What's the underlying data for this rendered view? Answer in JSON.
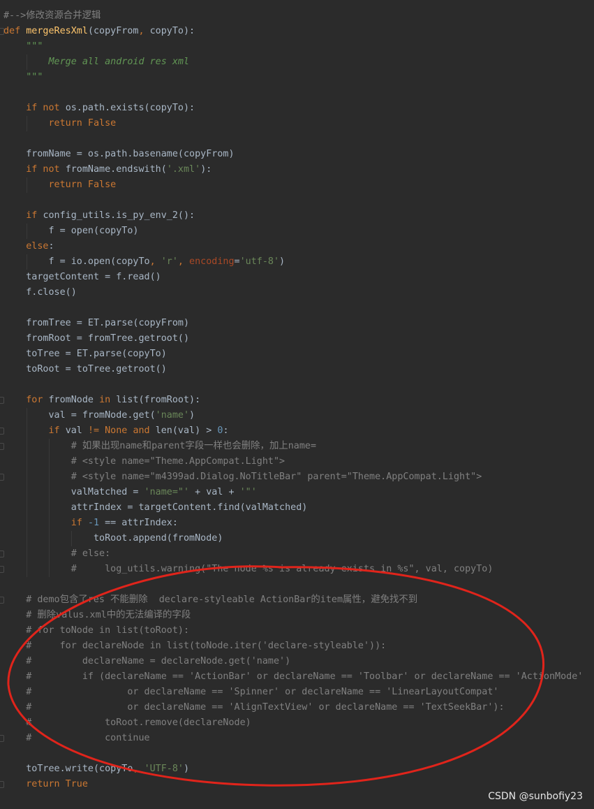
{
  "editor": {
    "lines": [
      {
        "tokens": [
          {
            "t": "#-->修改资源合并逻辑",
            "c": "cm"
          }
        ]
      },
      {
        "tokens": [
          {
            "t": "def ",
            "c": "kw"
          },
          {
            "t": "mergeResXml",
            "c": "fn"
          },
          {
            "t": "(",
            "c": "plain"
          },
          {
            "t": "copyFrom",
            "c": "plain"
          },
          {
            "t": ", ",
            "c": "kw"
          },
          {
            "t": "copyTo",
            "c": "plain"
          },
          {
            "t": "):",
            "c": "plain"
          }
        ],
        "fold": true
      },
      {
        "tokens": [
          {
            "t": "    \"\"\"",
            "c": "doc"
          }
        ]
      },
      {
        "tokens": [
          {
            "t": "        Merge all android res xml",
            "c": "doc"
          }
        ]
      },
      {
        "tokens": [
          {
            "t": "    \"\"\"",
            "c": "doc"
          }
        ]
      },
      {
        "tokens": []
      },
      {
        "tokens": [
          {
            "t": "    if not ",
            "c": "kw"
          },
          {
            "t": "os.path.exists(copyTo):",
            "c": "plain"
          }
        ]
      },
      {
        "tokens": [
          {
            "t": "        return False",
            "c": "kw"
          }
        ]
      },
      {
        "tokens": []
      },
      {
        "tokens": [
          {
            "t": "    fromName = os.path.basename(copyFrom)",
            "c": "plain"
          }
        ]
      },
      {
        "tokens": [
          {
            "t": "    if not ",
            "c": "kw"
          },
          {
            "t": "fromName.endswith(",
            "c": "plain"
          },
          {
            "t": "'.xml'",
            "c": "str"
          },
          {
            "t": "):",
            "c": "plain"
          }
        ]
      },
      {
        "tokens": [
          {
            "t": "        return False",
            "c": "kw"
          }
        ]
      },
      {
        "tokens": []
      },
      {
        "tokens": [
          {
            "t": "    if ",
            "c": "kw"
          },
          {
            "t": "config_utils.is_py_env_2():",
            "c": "plain"
          }
        ]
      },
      {
        "tokens": [
          {
            "t": "        f = open(copyTo)",
            "c": "plain"
          }
        ]
      },
      {
        "tokens": [
          {
            "t": "    else",
            "c": "kw"
          },
          {
            "t": ":",
            "c": "plain"
          }
        ]
      },
      {
        "tokens": [
          {
            "t": "        f = io.open(copyTo",
            "c": "plain"
          },
          {
            "t": ", ",
            "c": "kw"
          },
          {
            "t": "'r'",
            "c": "str"
          },
          {
            "t": ", ",
            "c": "kw"
          },
          {
            "t": "encoding",
            "c": "param"
          },
          {
            "t": "=",
            "c": "plain"
          },
          {
            "t": "'utf-8'",
            "c": "str"
          },
          {
            "t": ")",
            "c": "plain"
          }
        ]
      },
      {
        "tokens": [
          {
            "t": "    targetContent = f.read()",
            "c": "plain"
          }
        ]
      },
      {
        "tokens": [
          {
            "t": "    f.close()",
            "c": "plain"
          }
        ]
      },
      {
        "tokens": []
      },
      {
        "tokens": [
          {
            "t": "    fromTree = ET.parse(copyFrom)",
            "c": "plain"
          }
        ]
      },
      {
        "tokens": [
          {
            "t": "    fromRoot = fromTree.getroot()",
            "c": "plain"
          }
        ]
      },
      {
        "tokens": [
          {
            "t": "    toTree = ET.parse(copyTo)",
            "c": "plain"
          }
        ]
      },
      {
        "tokens": [
          {
            "t": "    toRoot = toTree.getroot()",
            "c": "plain"
          }
        ]
      },
      {
        "tokens": []
      },
      {
        "tokens": [
          {
            "t": "    for ",
            "c": "kw"
          },
          {
            "t": "fromNode ",
            "c": "plain"
          },
          {
            "t": "in ",
            "c": "kw"
          },
          {
            "t": "list(fromRoot):",
            "c": "plain"
          }
        ],
        "fold": true
      },
      {
        "tokens": [
          {
            "t": "        val = fromNode.get(",
            "c": "plain"
          },
          {
            "t": "'name'",
            "c": "str"
          },
          {
            "t": ")",
            "c": "plain"
          }
        ]
      },
      {
        "tokens": [
          {
            "t": "        if ",
            "c": "kw"
          },
          {
            "t": "val ",
            "c": "plain"
          },
          {
            "t": "!= None ",
            "c": "kw"
          },
          {
            "t": "and ",
            "c": "kw"
          },
          {
            "t": "len(val) > ",
            "c": "plain"
          },
          {
            "t": "0",
            "c": "num"
          },
          {
            "t": ":",
            "c": "plain"
          }
        ],
        "fold": true
      },
      {
        "tokens": [
          {
            "t": "            # 如果出现name和parent字段一样也会删除，加上name=",
            "c": "cm"
          }
        ],
        "fold": true
      },
      {
        "tokens": [
          {
            "t": "            # <style name=\"Theme.AppCompat.Light\">",
            "c": "cm"
          }
        ]
      },
      {
        "tokens": [
          {
            "t": "            # <style name=\"m4399ad.Dialog.NoTitleBar\" parent=\"Theme.AppCompat.Light\">",
            "c": "cm"
          }
        ],
        "fold": true
      },
      {
        "tokens": [
          {
            "t": "            valMatched = ",
            "c": "plain"
          },
          {
            "t": "'name=\"'",
            "c": "str"
          },
          {
            "t": " + val + ",
            "c": "plain"
          },
          {
            "t": "'\"'",
            "c": "str"
          }
        ]
      },
      {
        "tokens": [
          {
            "t": "            attrIndex = targetContent.find(valMatched)",
            "c": "plain"
          }
        ]
      },
      {
        "tokens": [
          {
            "t": "            if ",
            "c": "kw"
          },
          {
            "t": "-1",
            "c": "num"
          },
          {
            "t": " == attrIndex:",
            "c": "plain"
          }
        ]
      },
      {
        "tokens": [
          {
            "t": "                toRoot.append(fromNode)",
            "c": "plain"
          }
        ]
      },
      {
        "tokens": [
          {
            "t": "            # else:",
            "c": "cm"
          }
        ],
        "fold": true
      },
      {
        "tokens": [
          {
            "t": "            #     log_utils.warning(\"The node %s is already exists in %s\", val, copyTo)",
            "c": "cm"
          }
        ],
        "fold": true
      },
      {
        "tokens": []
      },
      {
        "tokens": [
          {
            "t": "    # demo包含了res 不能删除  declare-styleable ActionBar的item属性，避免找不到",
            "c": "cm"
          }
        ],
        "fold": true
      },
      {
        "tokens": [
          {
            "t": "    # 删除valus.xml中的无法编译的字段",
            "c": "cm"
          }
        ]
      },
      {
        "tokens": [
          {
            "t": "    # for toNode in list(toRoot):",
            "c": "cm"
          }
        ]
      },
      {
        "tokens": [
          {
            "t": "    #     for declareNode in list(toNode.iter('declare-styleable')):",
            "c": "cm"
          }
        ]
      },
      {
        "tokens": [
          {
            "t": "    #         declareName = declareNode.get('name')",
            "c": "cm"
          }
        ]
      },
      {
        "tokens": [
          {
            "t": "    #         if (declareName == 'ActionBar' or declareName == 'Toolbar' or declareName == 'ActionMode'",
            "c": "cm"
          }
        ]
      },
      {
        "tokens": [
          {
            "t": "    #                 or declareName == 'Spinner' or declareName == 'LinearLayoutCompat'",
            "c": "cm"
          }
        ]
      },
      {
        "tokens": [
          {
            "t": "    #                 or declareName == 'AlignTextView' or declareName == 'TextSeekBar'):",
            "c": "cm"
          }
        ]
      },
      {
        "tokens": [
          {
            "t": "    #             toRoot.remove(declareNode)",
            "c": "cm"
          }
        ]
      },
      {
        "tokens": [
          {
            "t": "    #             continue",
            "c": "cm"
          }
        ],
        "fold": true
      },
      {
        "tokens": []
      },
      {
        "tokens": [
          {
            "t": "    toTree.write(copyTo",
            "c": "plain"
          },
          {
            "t": ", ",
            "c": "kw"
          },
          {
            "t": "'UTF-8'",
            "c": "str"
          },
          {
            "t": ")",
            "c": "plain"
          }
        ]
      },
      {
        "tokens": [
          {
            "t": "    return True",
            "c": "kw"
          }
        ],
        "fold": true
      }
    ]
  },
  "annotation": {
    "shape": "ellipse",
    "color": "#e0241b"
  },
  "watermark": {
    "text": "CSDN @sunbofiy23"
  }
}
